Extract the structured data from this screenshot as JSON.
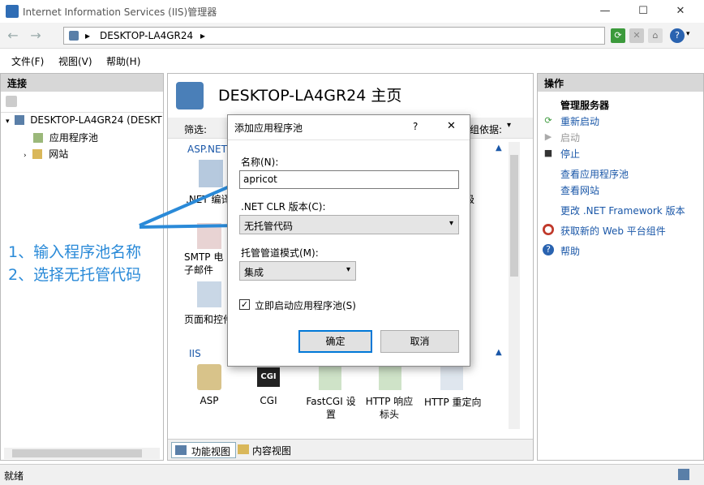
{
  "window": {
    "title": "Internet Information Services (IIS)管理器",
    "minimize": "—",
    "maximize": "☐",
    "close": "✕"
  },
  "address": {
    "path": "DESKTOP-LA4GR24",
    "separator": "▸"
  },
  "menu": [
    "文件(F)",
    "视图(V)",
    "帮助(H)"
  ],
  "connections": {
    "header": "连接",
    "server": "DESKTOP-LA4GR24 (DESKT",
    "app_pools": "应用程序池",
    "sites": "网站"
  },
  "center": {
    "title": "DESKTOP-LA4GR24 主页",
    "filter_label": "筛选:",
    "group_label": "组依据:",
    "section_aspnet": "ASP.NET",
    "section_iis": "IIS",
    "aspnet_items": [
      ".NET 编译",
      "SMTP 电子邮件",
      "页面和控件"
    ],
    "aspnet_partial": "级",
    "iis_items": [
      "ASP",
      "CGI",
      "FastCGI 设置",
      "HTTP 响应标头",
      "HTTP 重定向"
    ],
    "cgi_icon_text": "CGI",
    "bottom_tabs": [
      "功能视图",
      "内容视图"
    ]
  },
  "actions": {
    "header": "操作",
    "group_title": "管理服务器",
    "items": [
      "重新启动",
      "启动",
      "停止",
      "查看应用程序池",
      "查看网站",
      "更改 .NET Framework 版本",
      "获取新的 Web 平台组件",
      "帮助"
    ]
  },
  "dialog": {
    "title": "添加应用程序池",
    "help": "?",
    "close": "✕",
    "name_label": "名称(N):",
    "name_value": "apricot",
    "clr_label": ".NET CLR 版本(C):",
    "clr_value": "无托管代码",
    "pipeline_label": "托管管道模式(M):",
    "pipeline_value": "集成",
    "start_checkbox": "立即启动应用程序池(S)",
    "ok": "确定",
    "cancel": "取消"
  },
  "annotation": {
    "line1": "1、输入程序池名称",
    "line2": "2、选择无托管代码"
  },
  "status": {
    "text": "就绪"
  },
  "colors": {
    "accent": "#2a8ad8",
    "link": "#1a57a8",
    "panel_header": "#d7d7d7"
  }
}
